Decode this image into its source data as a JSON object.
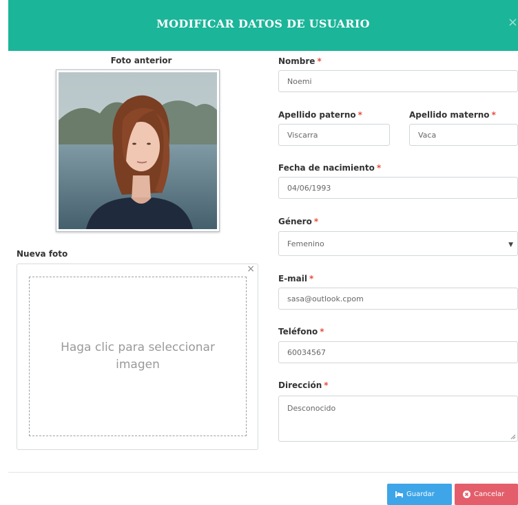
{
  "modal": {
    "title": "MODIFICAR DATOS DE USUARIO",
    "close_glyph": "×"
  },
  "photo": {
    "old_label": "Foto anterior",
    "new_label": "Nueva foto",
    "dropzone_text": "Haga clic para seleccionar imagen",
    "dropzone_close": "×"
  },
  "form": {
    "required_mark": "*",
    "nombre": {
      "label": "Nombre",
      "value": "Noemi"
    },
    "apellido_paterno": {
      "label": "Apellido paterno",
      "value": "Viscarra"
    },
    "apellido_materno": {
      "label": "Apellido materno",
      "value": "Vaca"
    },
    "fecha_nacimiento": {
      "label": "Fecha de nacimiento",
      "value": "04/06/1993"
    },
    "genero": {
      "label": "Género",
      "value": "Femenino"
    },
    "email": {
      "label": "E-mail",
      "value": "sasa@outlook.cpom"
    },
    "telefono": {
      "label": "Teléfono",
      "value": "60034567"
    },
    "direccion": {
      "label": "Dirección",
      "value": "Desconocido"
    }
  },
  "footer": {
    "save_label": "Guardar",
    "cancel_label": "Cancelar",
    "save_icon": "bed-icon",
    "cancel_icon": "circle-x-icon"
  },
  "colors": {
    "header": "#1bb599",
    "save": "#3da5e8",
    "cancel": "#e35d6a",
    "required": "#e74c3c"
  }
}
